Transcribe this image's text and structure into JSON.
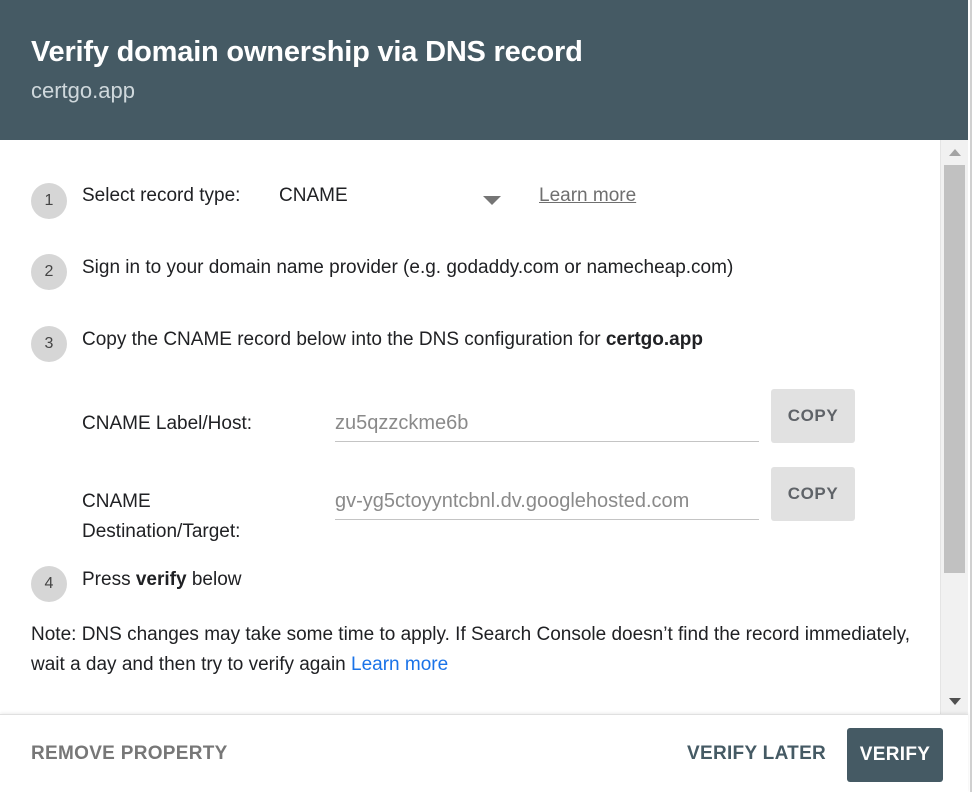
{
  "header": {
    "title": "Verify domain ownership via DNS record",
    "subtitle": "certgo.app"
  },
  "steps": [
    {
      "number": "1",
      "text": "Select record type:"
    },
    {
      "number": "2",
      "text": "Sign in to your domain name provider (e.g. godaddy.com or namecheap.com)"
    },
    {
      "number": "3",
      "text_prefix": "Copy the CNAME record below into the DNS configuration for ",
      "text_bold": "certgo.app"
    },
    {
      "number": "4",
      "text_prefix": "Press ",
      "text_bold": "verify",
      "text_suffix": " below"
    }
  ],
  "record_type": {
    "selected": "CNAME",
    "learn_more": "Learn more"
  },
  "fields": [
    {
      "label": "CNAME Label/Host:",
      "value": "zu5qzzckme6b",
      "copy_label": "COPY"
    },
    {
      "label_line1": "CNAME",
      "label_line2": "Destination/Target:",
      "value": "gv-yg5ctoyyntcbnl.dv.googlehosted.com",
      "copy_label": "COPY"
    }
  ],
  "note": {
    "text": "Note: DNS changes may take some time to apply. If Search Console doesn’t find the record immediately, wait a day and then try to verify again ",
    "link": "Learn more"
  },
  "footer": {
    "remove": "REMOVE PROPERTY",
    "later": "VERIFY LATER",
    "verify": "VERIFY"
  },
  "colors": {
    "header_bg": "#455a64",
    "primary_button": "#455a64",
    "link": "#1a73e8"
  }
}
